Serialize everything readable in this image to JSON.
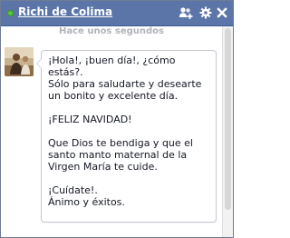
{
  "chat": {
    "contact_name": "Richi de Colima",
    "status": "online",
    "status_color": "#55c837",
    "titlebar_color": "#5c75a9",
    "icons": {
      "add_friends": "add-friends-icon",
      "settings": "gear-icon",
      "close": "close-icon"
    }
  },
  "conversation": {
    "timestamp": "Hace unos segundos",
    "messages": [
      {
        "sender": "Richi de Colima",
        "avatar": "avatar-photo",
        "text": "¡Hola!, ¡buen día!, ¿cómo estás?.\nSólo para saludarte y desearte un bonito y excelente día.\n\n¡FELIZ NAVIDAD!\n\nQue Dios te bendiga y que el santo manto maternal de la Virgen María te cuide.\n\n¡Cuídate!.\nÁnimo y éxitos."
      }
    ]
  }
}
